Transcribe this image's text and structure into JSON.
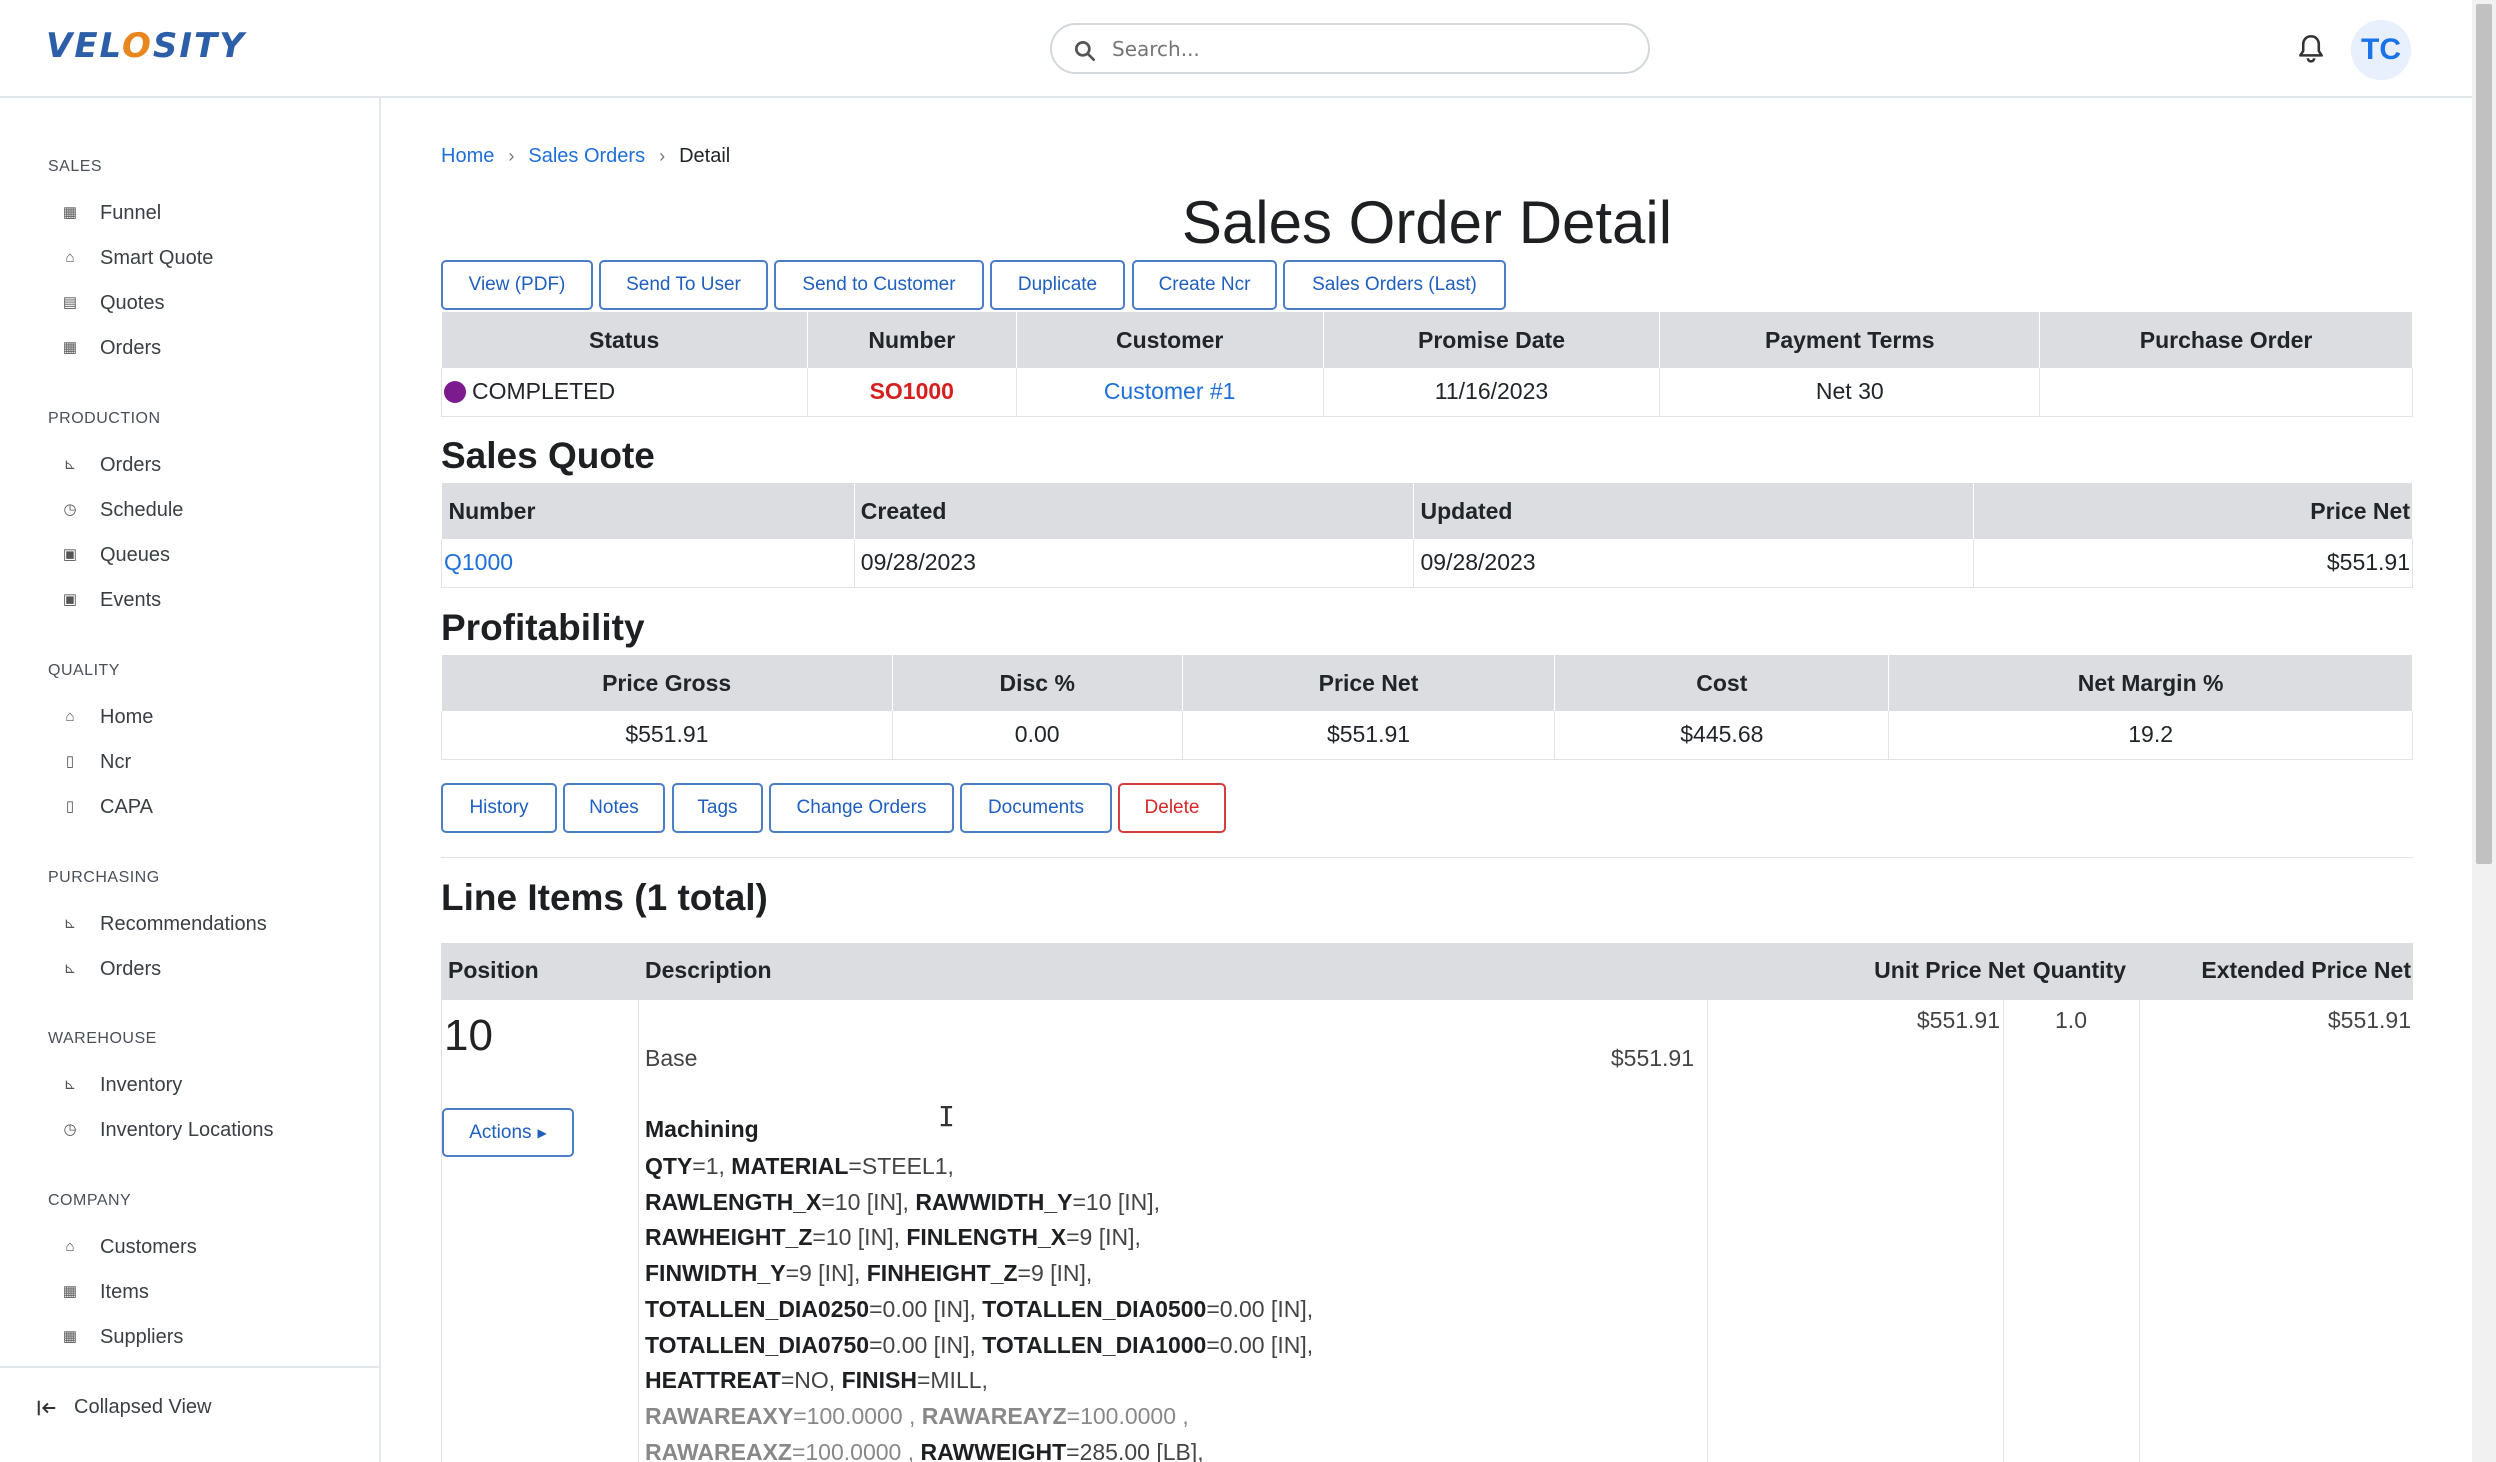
{
  "app": {
    "logo_text_a": "VEL",
    "logo_text_o": "O",
    "logo_text_b": "SITY"
  },
  "header": {
    "search_placeholder": "Search...",
    "avatar_initials": "TC"
  },
  "sidebar": {
    "sections": [
      {
        "title": "SALES",
        "items": [
          "Funnel",
          "Smart Quote",
          "Quotes",
          "Orders"
        ]
      },
      {
        "title": "PRODUCTION",
        "items": [
          "Orders",
          "Schedule",
          "Queues",
          "Events"
        ]
      },
      {
        "title": "QUALITY",
        "items": [
          "Home",
          "Ncr",
          "CAPA"
        ]
      },
      {
        "title": "PURCHASING",
        "items": [
          "Recommendations",
          "Orders"
        ]
      },
      {
        "title": "WAREHOUSE",
        "items": [
          "Inventory",
          "Inventory Locations"
        ]
      },
      {
        "title": "COMPANY",
        "items": [
          "Customers",
          "Items",
          "Suppliers"
        ]
      }
    ],
    "collapse_label": "Collapsed View"
  },
  "breadcrumb": {
    "home": "Home",
    "sales_orders": "Sales Orders",
    "current": "Detail"
  },
  "page_title": "Sales Order Detail",
  "toolbar": {
    "view_pdf": "View (PDF)",
    "send_to_user": "Send To User",
    "send_to_customer": "Send to Customer",
    "duplicate": "Duplicate",
    "create_ncr": "Create Ncr",
    "sales_orders_last": "Sales Orders (Last)"
  },
  "order": {
    "headers": [
      "Status",
      "Number",
      "Customer",
      "Promise Date",
      "Payment Terms",
      "Purchase Order"
    ],
    "status": "COMPLETED",
    "status_color": "#7b1b8f",
    "number": "SO1000",
    "customer": "Customer #1",
    "promise_date": "11/16/2023",
    "payment_terms": "Net 30",
    "purchase_order": ""
  },
  "sales_quote": {
    "title": "Sales Quote",
    "headers": [
      "Number",
      "Created",
      "Updated",
      "Price Net"
    ],
    "number": "Q1000",
    "created": "09/28/2023",
    "updated": "09/28/2023",
    "price_net": "$551.91"
  },
  "profitability": {
    "title": "Profitability",
    "headers": [
      "Price Gross",
      "Disc %",
      "Price Net",
      "Cost",
      "Net Margin %"
    ],
    "price_gross": "$551.91",
    "disc_pct": "0.00",
    "price_net": "$551.91",
    "cost": "$445.68",
    "net_margin_pct": "19.2"
  },
  "actions_bar": {
    "history": "History",
    "notes": "Notes",
    "tags": "Tags",
    "change_orders": "Change Orders",
    "documents": "Documents",
    "delete": "Delete"
  },
  "line_items": {
    "title": "Line Items (1 total)",
    "headers": [
      "Position",
      "Description",
      "Unit Price Net",
      "Quantity",
      "Extended Price Net"
    ],
    "rows": [
      {
        "position": "10",
        "actions_label": "Actions",
        "base_label": "Base",
        "base_price": "$551.91",
        "section": "Machining",
        "unit_price_net": "$551.91",
        "quantity": "1.0",
        "extended_price_net": "$551.91",
        "spec": {
          "qty_k": "QTY",
          "qty_v": "=1, ",
          "material_k": "MATERIAL",
          "material_v": "=STEEL1,",
          "rawlength_k": "RAWLENGTH_X",
          "rawlength_v": "=10 [IN], ",
          "rawwidth_k": "RAWWIDTH_Y",
          "rawwidth_v": "=10 [IN],",
          "rawheight_k": "RAWHEIGHT_Z",
          "rawheight_v": "=10 [IN], ",
          "finlength_k": "FINLENGTH_X",
          "finlength_v": "=9 [IN],",
          "finwidth_k": "FINWIDTH_Y",
          "finwidth_v": "=9 [IN], ",
          "finheight_k": "FINHEIGHT_Z",
          "finheight_v": "=9 [IN],",
          "tot0250_k": "TOTALLEN_DIA0250",
          "tot0250_v": "=0.00 [IN], ",
          "tot0500_k": "TOTALLEN_DIA0500",
          "tot0500_v": "=0.00 [IN],",
          "tot0750_k": "TOTALLEN_DIA0750",
          "tot0750_v": "=0.00 [IN], ",
          "tot1000_k": "TOTALLEN_DIA1000",
          "tot1000_v": "=0.00 [IN],",
          "heattreat_k": "HEATTREAT",
          "heattreat_v": "=NO, ",
          "finish_k": "FINISH",
          "finish_v": "=MILL,",
          "rawareaxy_k": "RAWAREAXY",
          "rawareaxy_v": "=100.0000 , ",
          "rawareayz_k": "RAWAREAYZ",
          "rawareayz_v": "=100.0000 ,",
          "rawareaxz_k": "RAWAREAXZ",
          "rawareaxz_v": "=100.0000 , ",
          "rawweight_k": "RAWWEIGHT",
          "rawweight_v": "=285.00 [LB],"
        }
      }
    ]
  }
}
